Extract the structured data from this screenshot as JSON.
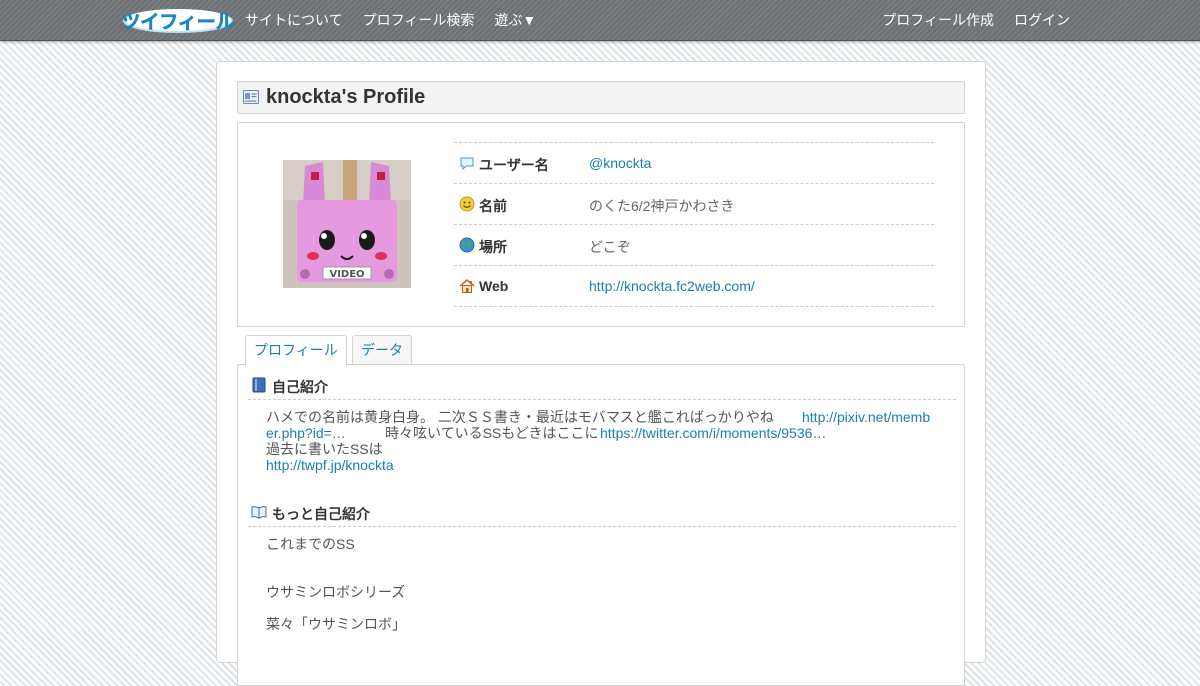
{
  "nav": {
    "logo_text": "ツイフィール",
    "left": [
      "サイトについて",
      "プロフィール検索",
      "遊ぶ▼"
    ],
    "right": [
      "プロフィール作成",
      "ログイン"
    ]
  },
  "profile": {
    "title": "knockta's Profile",
    "avatar_text": "VIDEO",
    "rows": [
      {
        "icon": "speech-bubble-icon",
        "label": "ユーザー名",
        "value": "@knockta",
        "is_link": true
      },
      {
        "icon": "smiley-icon",
        "label": "名前",
        "value": "のくた6/2神戸かわさき",
        "is_link": false
      },
      {
        "icon": "globe-icon",
        "label": "場所",
        "value": "どこぞ",
        "is_link": false
      },
      {
        "icon": "home-icon",
        "label": "Web",
        "value": "http://knockta.fc2web.com/",
        "is_link": true
      }
    ]
  },
  "tabs": [
    {
      "label": "プロフィール",
      "active": true
    },
    {
      "label": "データ",
      "active": false
    }
  ],
  "sections": {
    "intro": {
      "title": "自己紹介",
      "line1_text": "ハメでの名前は黄身白身。 二次ＳＳ書き・最近はモバマスと艦こればっかりやね",
      "line1_link": "http://pixiv.net/memb",
      "line2_link": "er.php?id=…",
      "line2_text": "時々呟いているSSもどきはここに",
      "line2_link2": "https://twitter.com/i/moments/9536…",
      "line3_text": "過去に書いたSSは",
      "line4_link": "http://twpf.jp/knockta"
    },
    "more": {
      "title": "もっと自己紹介",
      "lines": [
        "これまでのSS",
        "ウサミンロボシリーズ",
        "菜々「ウサミンロボ」"
      ]
    }
  },
  "colors": {
    "link": "#1a7fae",
    "nav_bg": "#75787b",
    "logo": "#2aa3e0"
  }
}
